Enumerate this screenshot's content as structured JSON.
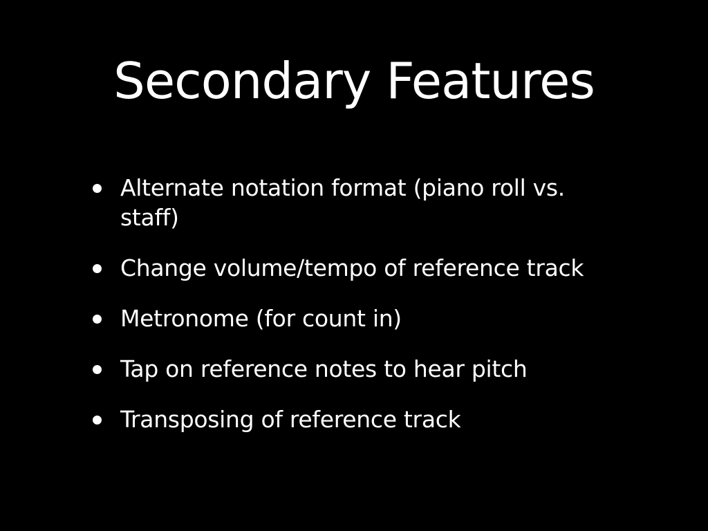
{
  "slide": {
    "title": "Secondary Features",
    "bullets": [
      "Alternate notation format (piano roll vs. staff)",
      "Change volume/tempo of reference track",
      "Metronome (for count in)",
      "Tap on reference notes to hear pitch",
      "Transposing of reference track"
    ]
  },
  "colors": {
    "background": "#000000",
    "text": "#ffffff"
  }
}
